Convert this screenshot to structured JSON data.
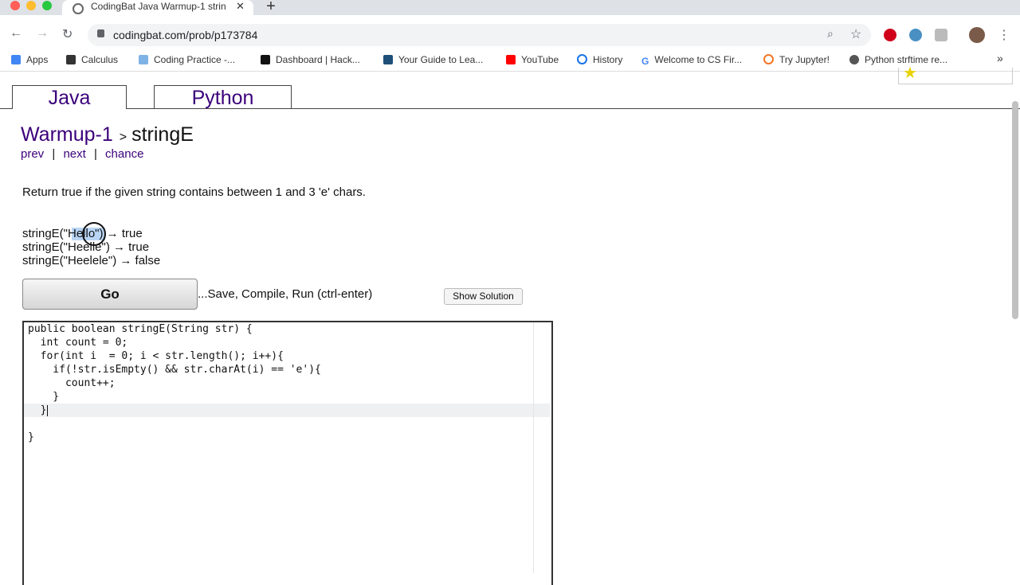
{
  "browser": {
    "tab_title": "CodingBat Java Warmup-1 strin",
    "tab_close": "✕",
    "new_tab": "+",
    "url": "codingbat.com/prob/p173784",
    "bookmarks": [
      "Apps",
      "Calculus",
      "Coding Practice -...",
      "Dashboard | Hack...",
      "Your Guide to Lea...",
      "YouTube",
      "History",
      "Welcome to CS Fir...",
      "Try Jupyter!",
      "Python strftime re..."
    ],
    "more": "»",
    "colors": {
      "youtube": "#ff0000",
      "opera": "#d0021b",
      "accent": "#1a73e8"
    }
  },
  "page": {
    "lang_tabs": [
      "Java",
      "Python"
    ],
    "breadcrumb": {
      "section": "Warmup-1",
      "separator": ">",
      "problem": "stringE"
    },
    "nav": {
      "prev": "prev",
      "divider": "|",
      "next": "next",
      "chance": "chance"
    },
    "prompt": "Return true if the given string contains between 1 and 3 'e' chars.",
    "examples": [
      "stringE(\"Hello\") → true",
      "stringE(\"Heelle\") → true",
      "stringE(\"Heelele\") → false"
    ],
    "go_label": "Go",
    "go_hint": "...Save, Compile, Run (ctrl-enter)",
    "show_solution": "Show Solution",
    "code_lines": [
      "public boolean stringE(String str) {",
      "  int count = 0;",
      "  for(int i  = 0; i < str.length(); i++){",
      "    if(!str.isEmpty() && str.charAt(i) == 'e'){",
      "      count++;",
      "    }",
      "  }",
      "",
      "}"
    ]
  }
}
